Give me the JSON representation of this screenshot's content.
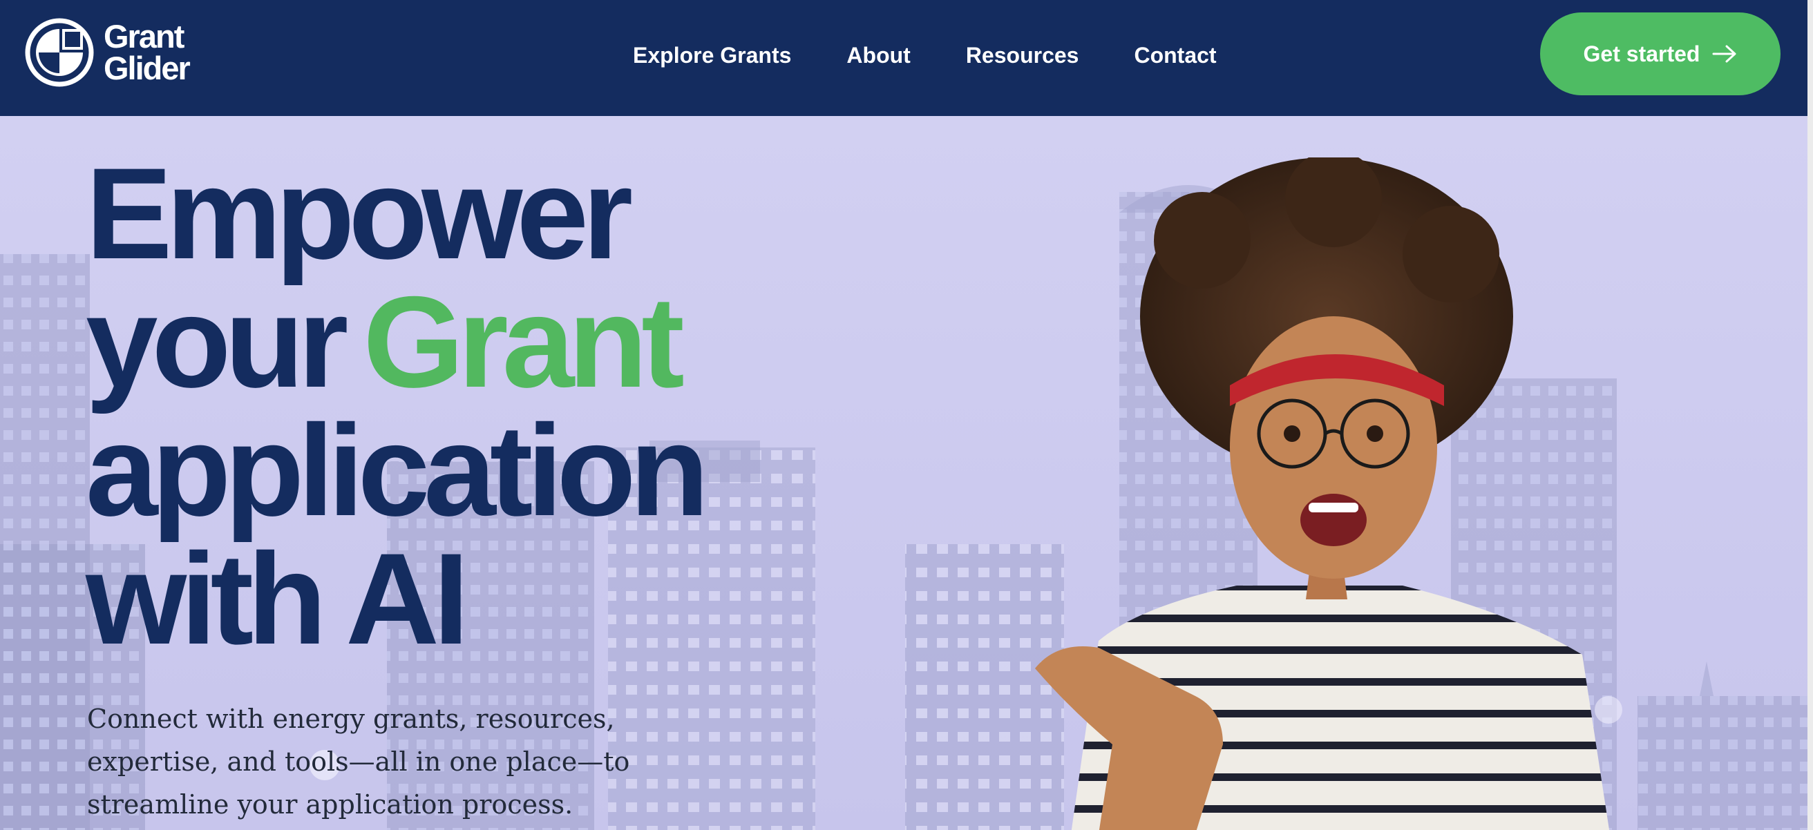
{
  "brand": {
    "name_line1": "Grant",
    "name_line2": "Glider",
    "logo_icon": "shield-g-icon",
    "navy": "#142c5f",
    "green": "#4ebc63",
    "highlight_bg": "#b3e3bf",
    "hero_tint": "#cfcdf0"
  },
  "nav": {
    "items": [
      {
        "label": "Explore Grants"
      },
      {
        "label": "About"
      },
      {
        "label": "Resources"
      },
      {
        "label": "Contact"
      }
    ]
  },
  "cta": {
    "label": "Get started",
    "icon": "arrow-right-icon"
  },
  "hero": {
    "headline_line1": "Empower",
    "headline_line2_prefix": "your",
    "headline_highlight": "Grant",
    "headline_line3": "application",
    "headline_line4": "with AI",
    "subtext": "Connect with energy grants, resources, expertise, and tools—all in one place—to streamline your application process.",
    "background": "city-skyline-image",
    "person": "smiling-woman-pointing-image"
  }
}
